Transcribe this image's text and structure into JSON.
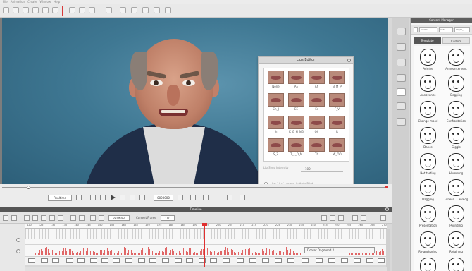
{
  "menu": [
    "File",
    "Animation",
    "Create",
    "Window",
    "Help"
  ],
  "lips_editor": {
    "title": "Lips Editor",
    "visemes": [
      "None",
      "AE",
      "Ah",
      "B_M_P",
      "Ch_J",
      "EE",
      "Er",
      "F_V",
      "Ih",
      "K_G_H_NG",
      "Oh",
      "R",
      "S_Z",
      "T_L_D_N",
      "Th",
      "W_OO"
    ],
    "slider_label": "Lip Sync Intensity",
    "slider_value": "100",
    "checkbox_label": "Use 'Lips' current in Auto Blink",
    "apply_button": "Apply"
  },
  "playback": {
    "realtime": "Realtime",
    "frame": "0000000"
  },
  "timeline": {
    "title": "Timeline",
    "realtime": "Realtime",
    "fps_label": "Current Frame",
    "fps_value": "100",
    "ruler": [
      "120",
      "125",
      "130",
      "135",
      "140",
      "145",
      "150",
      "155",
      "160",
      "165",
      "170",
      "175",
      "180",
      "185",
      "190",
      "195",
      "200",
      "205",
      "210",
      "215",
      "220",
      "225",
      "230",
      "235",
      "240",
      "245",
      "250",
      "255",
      "260",
      "265",
      "270"
    ],
    "clip_label": "Dooter Dagmond   2"
  },
  "content_manager": {
    "title": "Content Manager",
    "filter_1": "iAvatar",
    "filter_2": "Auto",
    "filter_3": "00_01_",
    "tabs": [
      "Template",
      "Custom"
    ],
    "templates": [
      "Admire",
      "Announcement",
      "Annoyance",
      "Begging",
      "Change mood",
      "Confrontation",
      "Dance",
      "Giggle",
      "Hot tasting",
      "Humming",
      "Nagging",
      "Fitness ... analog",
      "Presentation",
      "Pounding",
      "Re-anchoring",
      "Retaining",
      "",
      ""
    ]
  },
  "colors": {
    "accent_red": "#e03030",
    "header_dark": "#555555"
  }
}
